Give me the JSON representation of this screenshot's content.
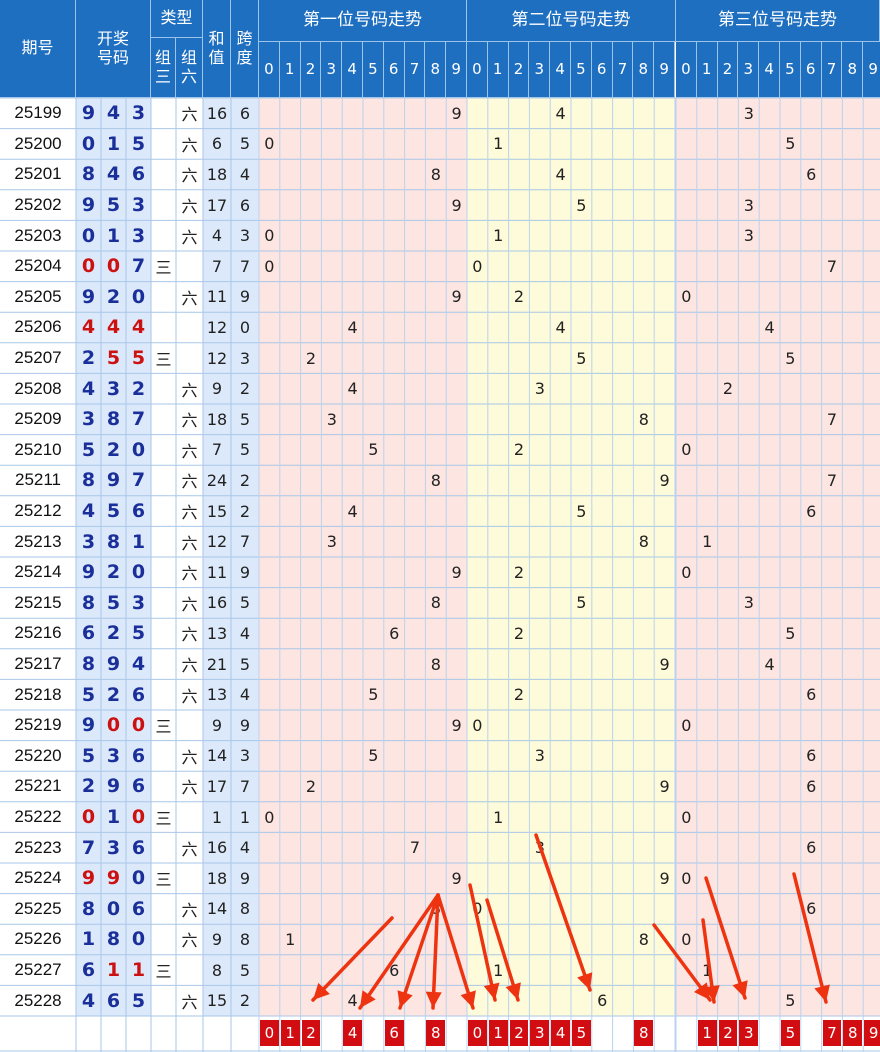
{
  "header": {
    "period_label": "期号",
    "draw_label_1": "开奖",
    "draw_label_2": "号码",
    "type_label": "类型",
    "zu_san_label_1": "组",
    "zu_san_label_2": "三",
    "zu_liu_label_1": "组",
    "zu_liu_label_2": "六",
    "sum_label_1": "和",
    "sum_label_2": "值",
    "span_label_1": "跨",
    "span_label_2": "度",
    "pos1_title": "第一位号码走势",
    "pos2_title": "第二位号码走势",
    "pos3_title": "第三位号码走势",
    "digits": [
      "0",
      "1",
      "2",
      "3",
      "4",
      "5",
      "6",
      "7",
      "8",
      "9"
    ]
  },
  "rows": [
    {
      "period": "25199",
      "d": [
        "9",
        "4",
        "3"
      ],
      "zu_san": "",
      "zu_liu": "六",
      "sum": "16",
      "span": "6"
    },
    {
      "period": "25200",
      "d": [
        "0",
        "1",
        "5"
      ],
      "zu_san": "",
      "zu_liu": "六",
      "sum": "6",
      "span": "5"
    },
    {
      "period": "25201",
      "d": [
        "8",
        "4",
        "6"
      ],
      "zu_san": "",
      "zu_liu": "六",
      "sum": "18",
      "span": "4"
    },
    {
      "period": "25202",
      "d": [
        "9",
        "5",
        "3"
      ],
      "zu_san": "",
      "zu_liu": "六",
      "sum": "17",
      "span": "6"
    },
    {
      "period": "25203",
      "d": [
        "0",
        "1",
        "3"
      ],
      "zu_san": "",
      "zu_liu": "六",
      "sum": "4",
      "span": "3"
    },
    {
      "period": "25204",
      "d": [
        "0",
        "0",
        "7"
      ],
      "zu_san": "三",
      "zu_liu": "",
      "sum": "7",
      "span": "7"
    },
    {
      "period": "25205",
      "d": [
        "9",
        "2",
        "0"
      ],
      "zu_san": "",
      "zu_liu": "六",
      "sum": "11",
      "span": "9"
    },
    {
      "period": "25206",
      "d": [
        "4",
        "4",
        "4"
      ],
      "zu_san": "",
      "zu_liu": "",
      "sum": "12",
      "span": "0"
    },
    {
      "period": "25207",
      "d": [
        "2",
        "5",
        "5"
      ],
      "zu_san": "三",
      "zu_liu": "",
      "sum": "12",
      "span": "3"
    },
    {
      "period": "25208",
      "d": [
        "4",
        "3",
        "2"
      ],
      "zu_san": "",
      "zu_liu": "六",
      "sum": "9",
      "span": "2"
    },
    {
      "period": "25209",
      "d": [
        "3",
        "8",
        "7"
      ],
      "zu_san": "",
      "zu_liu": "六",
      "sum": "18",
      "span": "5"
    },
    {
      "period": "25210",
      "d": [
        "5",
        "2",
        "0"
      ],
      "zu_san": "",
      "zu_liu": "六",
      "sum": "7",
      "span": "5"
    },
    {
      "period": "25211",
      "d": [
        "8",
        "9",
        "7"
      ],
      "zu_san": "",
      "zu_liu": "六",
      "sum": "24",
      "span": "2"
    },
    {
      "period": "25212",
      "d": [
        "4",
        "5",
        "6"
      ],
      "zu_san": "",
      "zu_liu": "六",
      "sum": "15",
      "span": "2"
    },
    {
      "period": "25213",
      "d": [
        "3",
        "8",
        "1"
      ],
      "zu_san": "",
      "zu_liu": "六",
      "sum": "12",
      "span": "7"
    },
    {
      "period": "25214",
      "d": [
        "9",
        "2",
        "0"
      ],
      "zu_san": "",
      "zu_liu": "六",
      "sum": "11",
      "span": "9"
    },
    {
      "period": "25215",
      "d": [
        "8",
        "5",
        "3"
      ],
      "zu_san": "",
      "zu_liu": "六",
      "sum": "16",
      "span": "5"
    },
    {
      "period": "25216",
      "d": [
        "6",
        "2",
        "5"
      ],
      "zu_san": "",
      "zu_liu": "六",
      "sum": "13",
      "span": "4"
    },
    {
      "period": "25217",
      "d": [
        "8",
        "9",
        "4"
      ],
      "zu_san": "",
      "zu_liu": "六",
      "sum": "21",
      "span": "5"
    },
    {
      "period": "25218",
      "d": [
        "5",
        "2",
        "6"
      ],
      "zu_san": "",
      "zu_liu": "六",
      "sum": "13",
      "span": "4"
    },
    {
      "period": "25219",
      "d": [
        "9",
        "0",
        "0"
      ],
      "zu_san": "三",
      "zu_liu": "",
      "sum": "9",
      "span": "9"
    },
    {
      "period": "25220",
      "d": [
        "5",
        "3",
        "6"
      ],
      "zu_san": "",
      "zu_liu": "六",
      "sum": "14",
      "span": "3"
    },
    {
      "period": "25221",
      "d": [
        "2",
        "9",
        "6"
      ],
      "zu_san": "",
      "zu_liu": "六",
      "sum": "17",
      "span": "7"
    },
    {
      "period": "25222",
      "d": [
        "0",
        "1",
        "0"
      ],
      "zu_san": "三",
      "zu_liu": "",
      "sum": "1",
      "span": "1"
    },
    {
      "period": "25223",
      "d": [
        "7",
        "3",
        "6"
      ],
      "zu_san": "",
      "zu_liu": "六",
      "sum": "16",
      "span": "4"
    },
    {
      "period": "25224",
      "d": [
        "9",
        "9",
        "0"
      ],
      "zu_san": "三",
      "zu_liu": "",
      "sum": "18",
      "span": "9"
    },
    {
      "period": "25225",
      "d": [
        "8",
        "0",
        "6"
      ],
      "zu_san": "",
      "zu_liu": "六",
      "sum": "14",
      "span": "8"
    },
    {
      "period": "25226",
      "d": [
        "1",
        "8",
        "0"
      ],
      "zu_san": "",
      "zu_liu": "六",
      "sum": "9",
      "span": "8"
    },
    {
      "period": "25227",
      "d": [
        "6",
        "1",
        "1"
      ],
      "zu_san": "三",
      "zu_liu": "",
      "sum": "8",
      "span": "5"
    },
    {
      "period": "25228",
      "d": [
        "4",
        "6",
        "5"
      ],
      "zu_san": "",
      "zu_liu": "六",
      "sum": "15",
      "span": "2"
    }
  ],
  "picks": {
    "pos1": [
      "0",
      "1",
      "2",
      "",
      "4",
      "",
      "6",
      "",
      "8",
      ""
    ],
    "pos2": [
      "0",
      "1",
      "2",
      "3",
      "4",
      "5",
      "",
      "",
      "8",
      ""
    ],
    "pos3": [
      "",
      "1",
      "2",
      "3",
      "",
      "5",
      "",
      "7",
      "8",
      "9"
    ]
  },
  "colors": {
    "header_blue": "#1f6fc1",
    "zone1_bg": "#fde5e1",
    "zone2_bg": "#fdfbd9",
    "zone3_bg": "#fde5e1",
    "number_blue": "#1a2f99",
    "repeat_red": "#cc1111",
    "pick_red": "#d10d12",
    "arrow_red": "#ee3311"
  }
}
